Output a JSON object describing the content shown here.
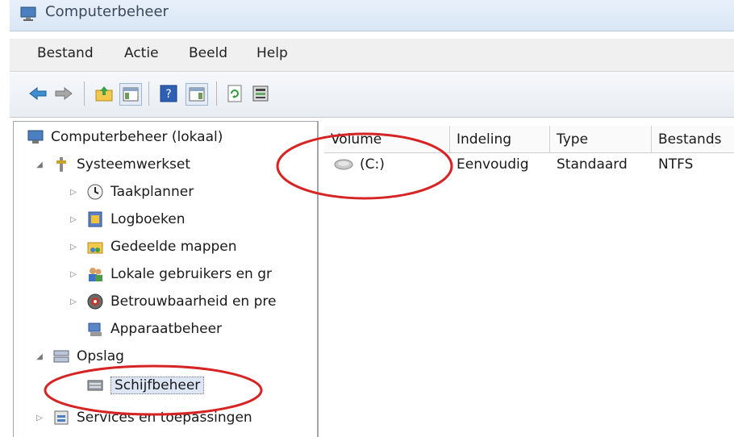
{
  "window": {
    "title": "Computerbeheer"
  },
  "menu": [
    "Bestand",
    "Actie",
    "Beeld",
    "Help"
  ],
  "toolbar": {
    "buttons": [
      "back-icon",
      "forward-icon",
      "up-folder-icon",
      "show-hide-tree-icon",
      "help-icon",
      "action-pane-icon",
      "refresh-icon",
      "properties-icon"
    ]
  },
  "tree": {
    "root": "Computerbeheer (lokaal)",
    "system_tools": "Systeemwerkset",
    "task_scheduler": "Taakplanner",
    "event_viewer": "Logboeken",
    "shared_folders": "Gedeelde mappen",
    "local_users": "Lokale gebruikers en gr",
    "reliability": "Betrouwbaarheid en pre",
    "device_manager": "Apparaatbeheer",
    "storage": "Opslag",
    "disk_management": "Schijfbeheer",
    "services": "Services en toepassingen"
  },
  "list": {
    "columns": [
      "Volume",
      "Indeling",
      "Type",
      "Bestands"
    ],
    "rows": [
      {
        "volume": "(C:)",
        "layout": "Eenvoudig",
        "type": "Standaard",
        "fs": "NTFS"
      }
    ]
  },
  "colors": {
    "annotation": "#d62424",
    "accent": "#2b6cb0"
  }
}
